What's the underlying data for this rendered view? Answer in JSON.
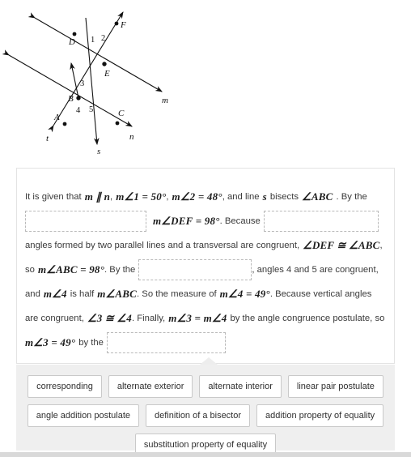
{
  "diagram": {
    "point_labels": [
      "D",
      "F",
      "E",
      "B",
      "A",
      "C"
    ],
    "angle_numbers": [
      "1",
      "2",
      "3",
      "4",
      "5"
    ],
    "line_labels": [
      "m",
      "n",
      "s",
      "t"
    ],
    "labels": {
      "D": "D",
      "F": "F",
      "E": "E",
      "B": "B",
      "A": "A",
      "C": "C",
      "n1": "1",
      "n2": "2",
      "n3": "3",
      "n4": "4",
      "n5": "5",
      "m": "m",
      "n": "n",
      "s": "s",
      "t": "t"
    }
  },
  "proof": {
    "line1": {
      "t1": "It is given that",
      "m1": "m ∥ n",
      "t2": ",",
      "m2": "m∠1 = 50°",
      "t3": ",",
      "m3": "m∠2 = 48°",
      "t4": ", and line",
      "m4": "s",
      "t5": "bisects",
      "m5": "∠ABC",
      "t6": ". By the"
    },
    "line2": {
      "m1": "m∠DEF = 98°",
      "t1": ". Because"
    },
    "line3": {
      "t1": "angles formed by two parallel lines and a transversal are congruent,",
      "m1": "∠DEF ≅ ∠ABC",
      "t2": ","
    },
    "line4": {
      "t1": "so",
      "m1": "m∠ABC = 98°",
      "t2": ". By the",
      "t3": ", angles 4 and 5 are congruent,"
    },
    "line5": {
      "t1": "and",
      "m1": "m∠4",
      "t2": "is half",
      "m2": "m∠ABC",
      "t3": ". So the measure of",
      "m3": "m∠4 = 49°",
      "t4": ". Because vertical angles"
    },
    "line6": {
      "t1": "are congruent,",
      "m1": "∠3 ≅ ∠4",
      "t2": ". Finally,",
      "m2": "m∠3 = m∠4",
      "t3": "by the angle congruence postulate, so"
    },
    "line7": {
      "m1": "m∠3 = 49°",
      "t1": "by the"
    },
    "blanks": [
      {
        "name": "blank-1",
        "value": ""
      },
      {
        "name": "blank-2",
        "value": ""
      },
      {
        "name": "blank-3",
        "value": ""
      },
      {
        "name": "blank-4",
        "value": ""
      }
    ]
  },
  "answer_bank": {
    "row1": [
      "corresponding",
      "alternate exterior",
      "alternate interior",
      "linear pair postulate"
    ],
    "row2": [
      "angle addition postulate",
      "definition of a bisector",
      "addition property of equality"
    ],
    "row3": [
      "substitution property of equality"
    ]
  },
  "colors": {
    "bank_background": "#efefef",
    "card_border": "#e3e3e3",
    "blank_border": "#b9b9b9",
    "choice_border": "#c9c9c9"
  }
}
